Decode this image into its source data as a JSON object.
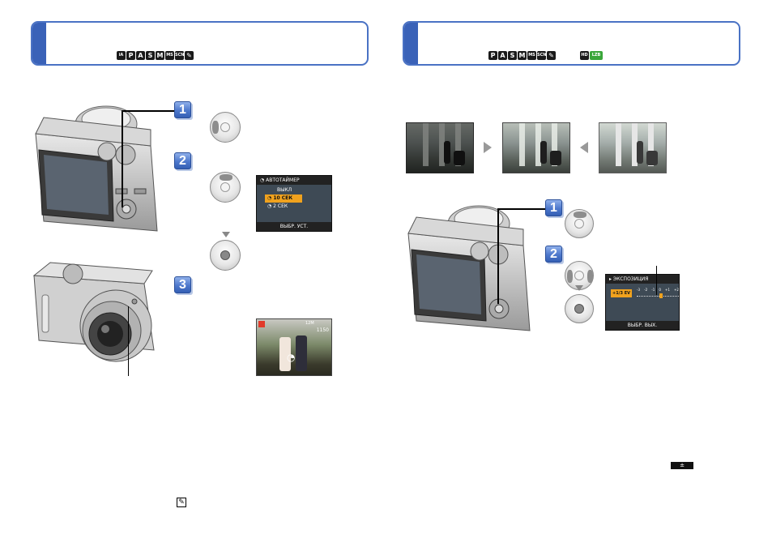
{
  "left": {
    "mode_icons": [
      "iA",
      "P",
      "A",
      "S",
      "M",
      "MS",
      "SCN",
      "✎"
    ],
    "steps": [
      "1",
      "2",
      "3"
    ],
    "self_timer_menu": {
      "title": "АВТОТАЙМЕР",
      "options": [
        "ВЫКЛ",
        "10 СЕК",
        "2 СЕК"
      ],
      "selected_index": 1,
      "footer": "ВЫБР. УСТ."
    },
    "preview_status": {
      "top_right": "12M",
      "count": "1150"
    },
    "footer_icon": "✎"
  },
  "right": {
    "mode_icons": [
      "P",
      "A",
      "S",
      "M",
      "MS",
      "SCN",
      "✎"
    ],
    "extra_icons": [
      "HD",
      "LZB"
    ],
    "steps": [
      "1",
      "2"
    ],
    "exposure_menu": {
      "title": "ЭКСПОЗИЦИЯ",
      "value": "+1/3 EV",
      "scale": [
        "-3",
        "-2",
        "-1",
        "0",
        "+1",
        "+2"
      ],
      "footer": "ВЫБР. ВЫХ."
    },
    "footer_badge": "±"
  }
}
